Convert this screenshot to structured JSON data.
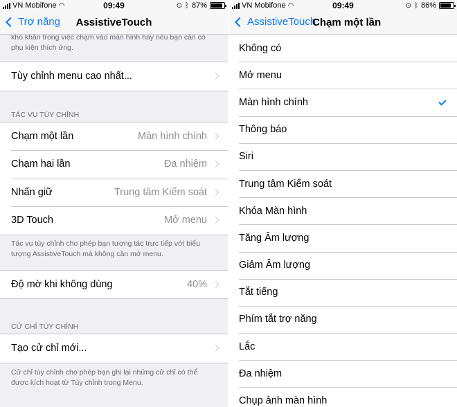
{
  "left": {
    "status": {
      "carrier": "VN Mobifone",
      "time": "09:49",
      "battery": "87%",
      "battery_level": 0.87
    },
    "nav": {
      "back": "Trợ năng",
      "title": "AssistiveTouch"
    },
    "top_note": "khó khăn trong việc chạm vào màn hình hay nếu bạn cần có phụ kiện thích ứng.",
    "customize_menu": "Tùy chỉnh menu cao nhất...",
    "custom_actions": {
      "header": "TÁC VỤ TÙY CHỈNH",
      "rows": [
        {
          "label": "Chạm một lần",
          "value": "Màn hình chính"
        },
        {
          "label": "Chạm hai lần",
          "value": "Đa nhiệm"
        },
        {
          "label": "Nhấn giữ",
          "value": "Trung tâm Kiểm soát"
        },
        {
          "label": "3D Touch",
          "value": "Mở menu"
        }
      ],
      "footer": "Tác vụ tùy chỉnh cho phép bạn tương tác trực tiếp với biểu tượng AssistiveTouch mà không cần mở menu."
    },
    "idle_opacity": {
      "label": "Độ mờ khi không dùng",
      "value": "40%"
    },
    "custom_gestures": {
      "header": "CỬ CHỈ TÙY CHỈNH",
      "new_gesture": "Tạo cử chỉ mới...",
      "footer": "Cử chỉ tùy chỉnh cho phép bạn ghi lại những cử chỉ có thể được kích hoạt từ Tùy chỉnh trong Menu."
    }
  },
  "right": {
    "status": {
      "carrier": "VN Mobifone",
      "time": "09:49",
      "battery": "86%",
      "battery_level": 0.86
    },
    "nav": {
      "back": "AssistiveTouch",
      "title": "Chạm một lần"
    },
    "selected": "Màn hình chính",
    "options": [
      "Không có",
      "Mở menu",
      "Màn hình chính",
      "Thông báo",
      "Siri",
      "Trung tâm Kiểm soát",
      "Khóa Màn hình",
      "Tăng Âm lượng",
      "Giảm Âm lượng",
      "Tắt tiếng",
      "Phím tắt trợ năng",
      "Lắc",
      "Đa nhiệm",
      "Chụp ảnh màn hình"
    ]
  },
  "colors": {
    "accent": "#007aff",
    "background": "#efeff4",
    "secondary_text": "#8e8e93"
  }
}
